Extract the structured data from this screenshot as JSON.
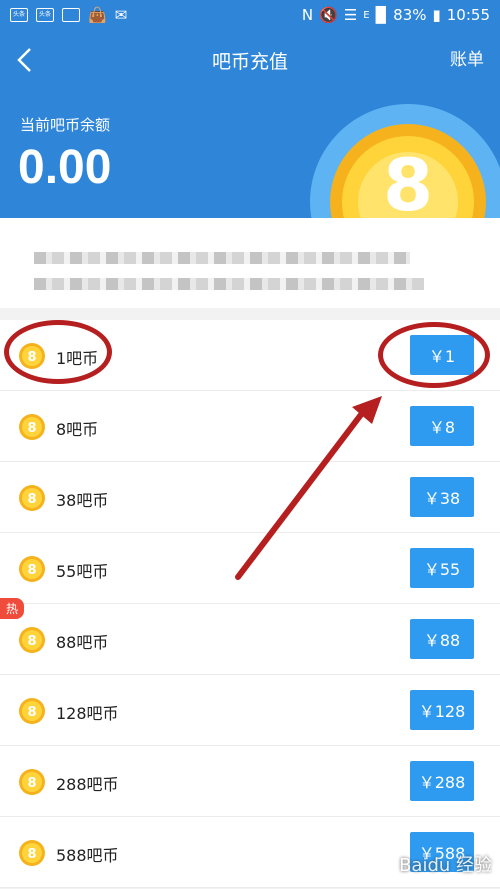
{
  "status_bar": {
    "battery": "83%",
    "time": "10:55",
    "notif_icons": [
      "头条",
      "头条"
    ],
    "network": "E"
  },
  "header": {
    "title": "吧币充值",
    "right_action": "账单"
  },
  "balance": {
    "label": "当前吧币余额",
    "value": "0.00"
  },
  "packages": [
    {
      "label": "1吧币",
      "price": "￥1"
    },
    {
      "label": "8吧币",
      "price": "￥8"
    },
    {
      "label": "38吧币",
      "price": "￥38"
    },
    {
      "label": "55吧币",
      "price": "￥55"
    },
    {
      "label": "88吧币",
      "price": "￥88",
      "tag": "热"
    },
    {
      "label": "128吧币",
      "price": "￥128"
    },
    {
      "label": "288吧币",
      "price": "￥288"
    },
    {
      "label": "588吧币",
      "price": "￥588"
    }
  ],
  "watermark": "Baidu 经验",
  "colors": {
    "primary": "#2f86d9",
    "button": "#2f9bf0",
    "hot": "#f04c3c",
    "annotation": "#b51f1f"
  }
}
